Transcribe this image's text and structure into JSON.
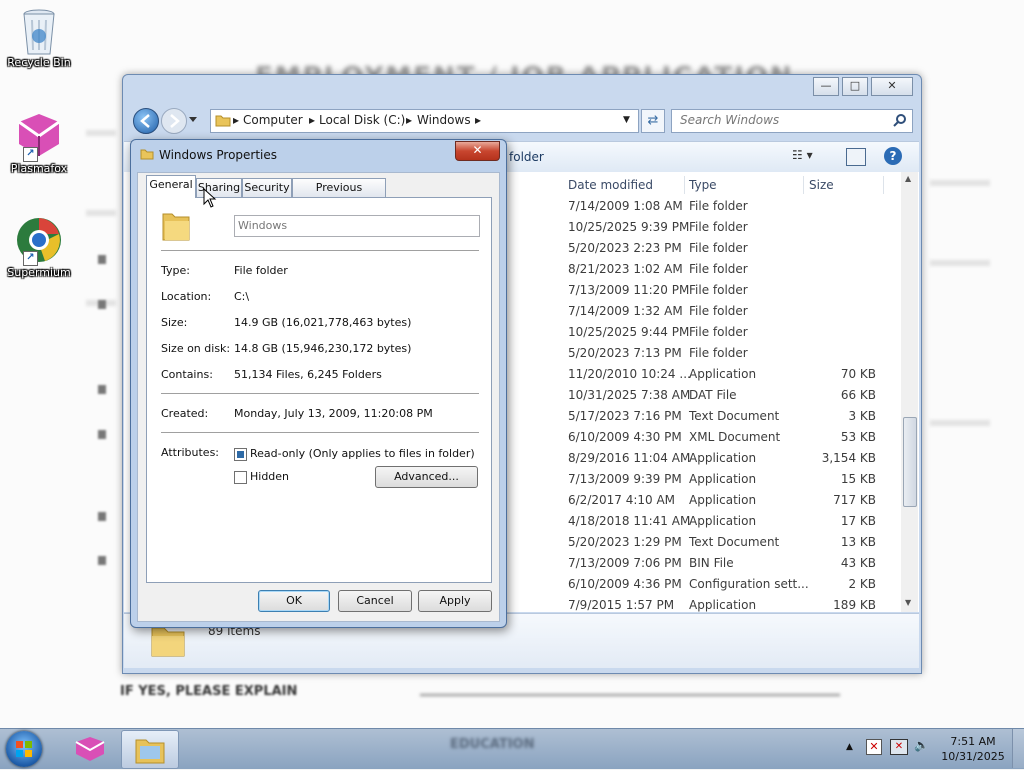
{
  "desktop": {
    "icons": [
      {
        "label": "Recycle Bin",
        "icon": "recycle-bin-icon"
      },
      {
        "label": "Plasmafox",
        "icon": "plasmafox-icon"
      },
      {
        "label": "Supermium",
        "icon": "supermium-icon"
      }
    ],
    "wallpaper": {
      "heading": "EMPLOYMENT / JOB APPLICATION",
      "footer_text": "IF YES, PLEASE EXPLAIN"
    }
  },
  "explorer": {
    "address": {
      "crumbs": [
        "Computer",
        "Local Disk (C:)",
        "Windows"
      ]
    },
    "search_placeholder": "Search Windows",
    "folder_label": "folder",
    "columns": {
      "date": "Date modified",
      "type": "Type",
      "size": "Size"
    },
    "rows": [
      {
        "date": "7/14/2009 1:08 AM",
        "type": "File folder",
        "size": ""
      },
      {
        "date": "10/25/2025 9:39 PM",
        "type": "File folder",
        "size": ""
      },
      {
        "date": "5/20/2023 2:23 PM",
        "type": "File folder",
        "size": ""
      },
      {
        "date": "8/21/2023 1:02 AM",
        "type": "File folder",
        "size": ""
      },
      {
        "date": "7/13/2009 11:20 PM",
        "type": "File folder",
        "size": ""
      },
      {
        "date": "7/14/2009 1:32 AM",
        "type": "File folder",
        "size": ""
      },
      {
        "date": "10/25/2025 9:44 PM",
        "type": "File folder",
        "size": ""
      },
      {
        "date": "5/20/2023 7:13 PM",
        "type": "File folder",
        "size": ""
      },
      {
        "date": "11/20/2010 10:24 ...",
        "type": "Application",
        "size": "70 KB"
      },
      {
        "date": "10/31/2025 7:38 AM",
        "type": "DAT File",
        "size": "66 KB"
      },
      {
        "date": "5/17/2023 7:16 PM",
        "type": "Text Document",
        "size": "3 KB"
      },
      {
        "date": "6/10/2009 4:30 PM",
        "type": "XML Document",
        "size": "53 KB"
      },
      {
        "date": "8/29/2016 11:04 AM",
        "type": "Application",
        "size": "3,154 KB"
      },
      {
        "date": "7/13/2009 9:39 PM",
        "type": "Application",
        "size": "15 KB"
      },
      {
        "date": "6/2/2017 4:10 AM",
        "type": "Application",
        "size": "717 KB"
      },
      {
        "date": "4/18/2018 11:41 AM",
        "type": "Application",
        "size": "17 KB"
      },
      {
        "date": "5/20/2023 1:29 PM",
        "type": "Text Document",
        "size": "13 KB"
      },
      {
        "date": "7/13/2009 7:06 PM",
        "type": "BIN File",
        "size": "43 KB"
      },
      {
        "date": "6/10/2009 4:36 PM",
        "type": "Configuration sett...",
        "size": "2 KB"
      },
      {
        "date": "7/9/2015 1:57 PM",
        "type": "Application",
        "size": "189 KB"
      }
    ],
    "details": {
      "item_count": "89 items"
    }
  },
  "properties": {
    "title": "Windows Properties",
    "close_glyph": "✕",
    "tabs": [
      "General",
      "Sharing",
      "Security",
      "Previous Versions"
    ],
    "active_tab": "General",
    "name_value": "Windows",
    "fields": [
      {
        "label": "Type:",
        "value": "File folder"
      },
      {
        "label": "Location:",
        "value": "C:\\"
      },
      {
        "label": "Size:",
        "value": "14.9 GB (16,021,778,463 bytes)"
      },
      {
        "label": "Size on disk:",
        "value": "14.8 GB (15,946,230,172 bytes)"
      },
      {
        "label": "Contains:",
        "value": "51,134 Files, 6,245 Folders"
      }
    ],
    "created": {
      "label": "Created:",
      "value": "Monday, July 13, 2009, 11:20:08 PM"
    },
    "attributes": {
      "label": "Attributes:",
      "readonly": {
        "label": "Read-only (Only applies to files in folder)",
        "checked": true
      },
      "hidden": {
        "label": "Hidden",
        "checked": false
      },
      "advanced_label": "Advanced..."
    },
    "buttons": {
      "ok": "OK",
      "cancel": "Cancel",
      "apply": "Apply"
    }
  },
  "taskbar": {
    "clock": {
      "time": "7:51 AM",
      "date": "10/31/2025"
    },
    "center_text": "EDUCATION"
  }
}
